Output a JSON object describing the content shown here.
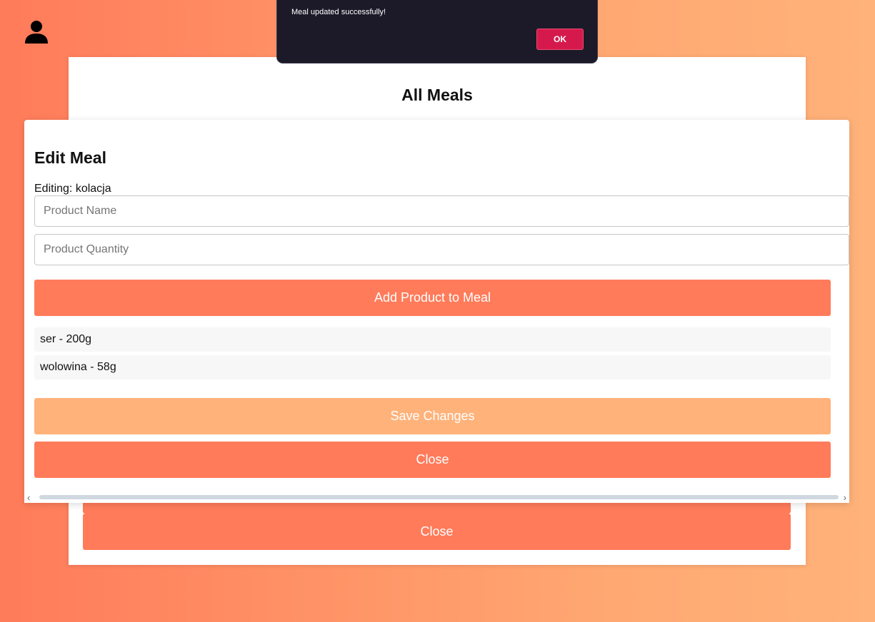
{
  "icons": {
    "user": "user-icon"
  },
  "colors": {
    "accent": "#ff7b5a",
    "accent_light": "#ffb27a",
    "toast_bg": "#1c1a29",
    "toast_button": "#d6194c"
  },
  "meals_panel": {
    "title": "All Meals",
    "close_label": "Close"
  },
  "modal": {
    "title": "Edit Meal",
    "editing_prefix": "Editing: ",
    "editing_name": "kolacja",
    "product_name_placeholder": "Product Name",
    "product_quantity_placeholder": "Product Quantity",
    "add_button": "Add Product to Meal",
    "products": [
      {
        "label": "ser - 200g"
      },
      {
        "label": "wolowina - 58g"
      }
    ],
    "save_button": "Save Changes",
    "close_button": "Close"
  },
  "toast": {
    "message": "Meal updated successfully!",
    "ok_label": "OK"
  }
}
